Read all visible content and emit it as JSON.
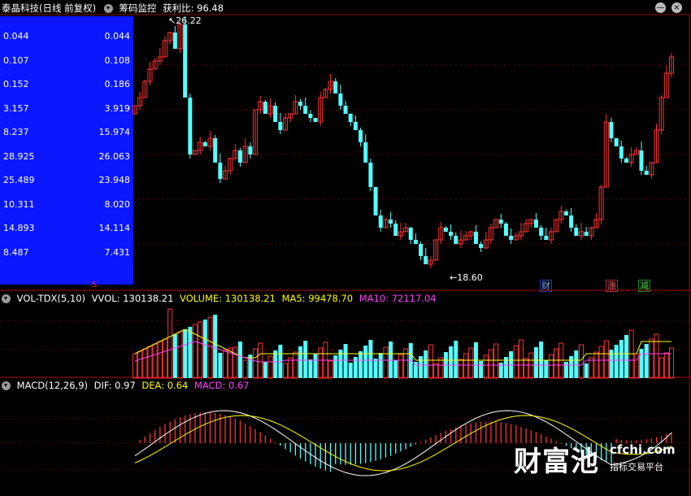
{
  "header": {
    "stock": "泰晶科技(日线 前复权)",
    "chips": "筹码监控",
    "profit_label": "获利比: 96.48"
  },
  "window": {
    "minimize": "—",
    "close": "×"
  },
  "left_panel": {
    "rows": [
      {
        "left": "0.044",
        "right": "0.044"
      },
      {
        "left": "0.107",
        "right": "0.108"
      },
      {
        "left": "0.152",
        "right": "0.186"
      },
      {
        "left": "3.157",
        "right": "3.919"
      },
      {
        "left": "8.237",
        "right": "15.974"
      },
      {
        "left": "28.925",
        "right": "26.063"
      },
      {
        "left": "25.489",
        "right": "23.948"
      },
      {
        "left": "10.311",
        "right": "8.020"
      },
      {
        "left": "14.893",
        "right": "14.114"
      },
      {
        "left": "8.487",
        "right": "7.431"
      }
    ]
  },
  "price_chart": {
    "high_label": "26.22",
    "low_label": "18.60",
    "markers": {
      "cai": "财",
      "zhang": "涨",
      "jian": "减",
      "s": "S"
    }
  },
  "volume_panel": {
    "indicator": "VOL-TDX(5,10)",
    "vvol": "VVOL: 130138.21",
    "volume": "VOLUME: 130138.21",
    "ma5": "MA5: 99478.70",
    "ma10": "MA10: 72117.04"
  },
  "macd_panel": {
    "indicator": "MACD(12,26,9)",
    "dif": "DIF: 0.97",
    "dea": "DEA: 0.64",
    "macd": "MACD: 0.67"
  },
  "watermark": {
    "logo": "财富池",
    "domain": "cfchi.com",
    "slogan": "指标交易平台"
  },
  "colors": {
    "up": "#ff3232",
    "down": "#54ffff",
    "panel": "#0a17ff",
    "yellow": "#ffff00",
    "magenta": "#ff40ff"
  }
}
